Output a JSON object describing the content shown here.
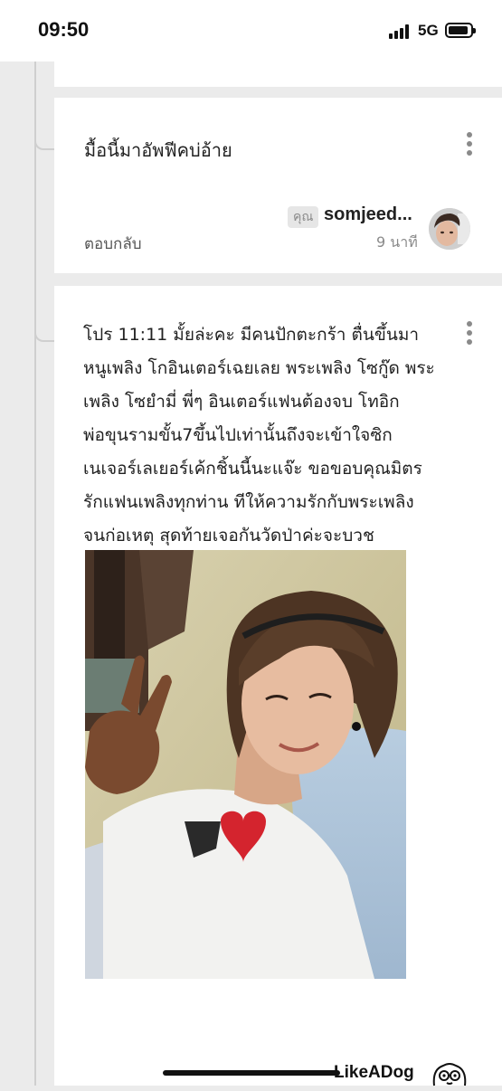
{
  "status_bar": {
    "time": "09:50",
    "network": "5G",
    "icons": [
      "signal-icon",
      "battery-icon"
    ]
  },
  "reply_comment": {
    "text": "มื้อนี้มาอัพฟีคบ่อ้าย",
    "badge": "คุณ",
    "username": "somjeed...",
    "timestamp": "9 นาที",
    "reply_button": "ตอบกลับ",
    "icons": [
      "more-vertical-icon",
      "avatar"
    ]
  },
  "post": {
    "text": "โปร 11:11 มั้ยล่ะคะ มีคนปักตะกร้า ตื่นขึ้นมา\nหนูเพลิง โกอินเตอร์เฉยเลย พระเพลิง โซกู๊ด พระ\nเพลิง โซยำมี่ พี่ๆ อินเตอร์แฟนต้องจบ โทอิก\nพ่อขุนรามขั้น7ขึ้นไปเท่านั้นถึงจะเข้าใจซิก\nเนเจอร์เลเยอร์เค้กชิ้นนี้นะแจ๊ะ ขอขอบคุณมิตร\nรักแฟนเพลิงทุกท่าน ทีให้ความรักกับพระเพลิง\nจนก่อเหตุ สุดท้ายเจอกันวัดป่าค่ะจะบวช",
    "icons": [
      "more-vertical-icon",
      "selfie-photo"
    ]
  },
  "watermark": {
    "text": "LikeADog",
    "icons": [
      "dog-logo-icon"
    ]
  },
  "colors": {
    "background": "#ebebeb",
    "card": "#ffffff",
    "muted_text": "#8a8a8a",
    "thread_line": "#cfcfcf"
  }
}
